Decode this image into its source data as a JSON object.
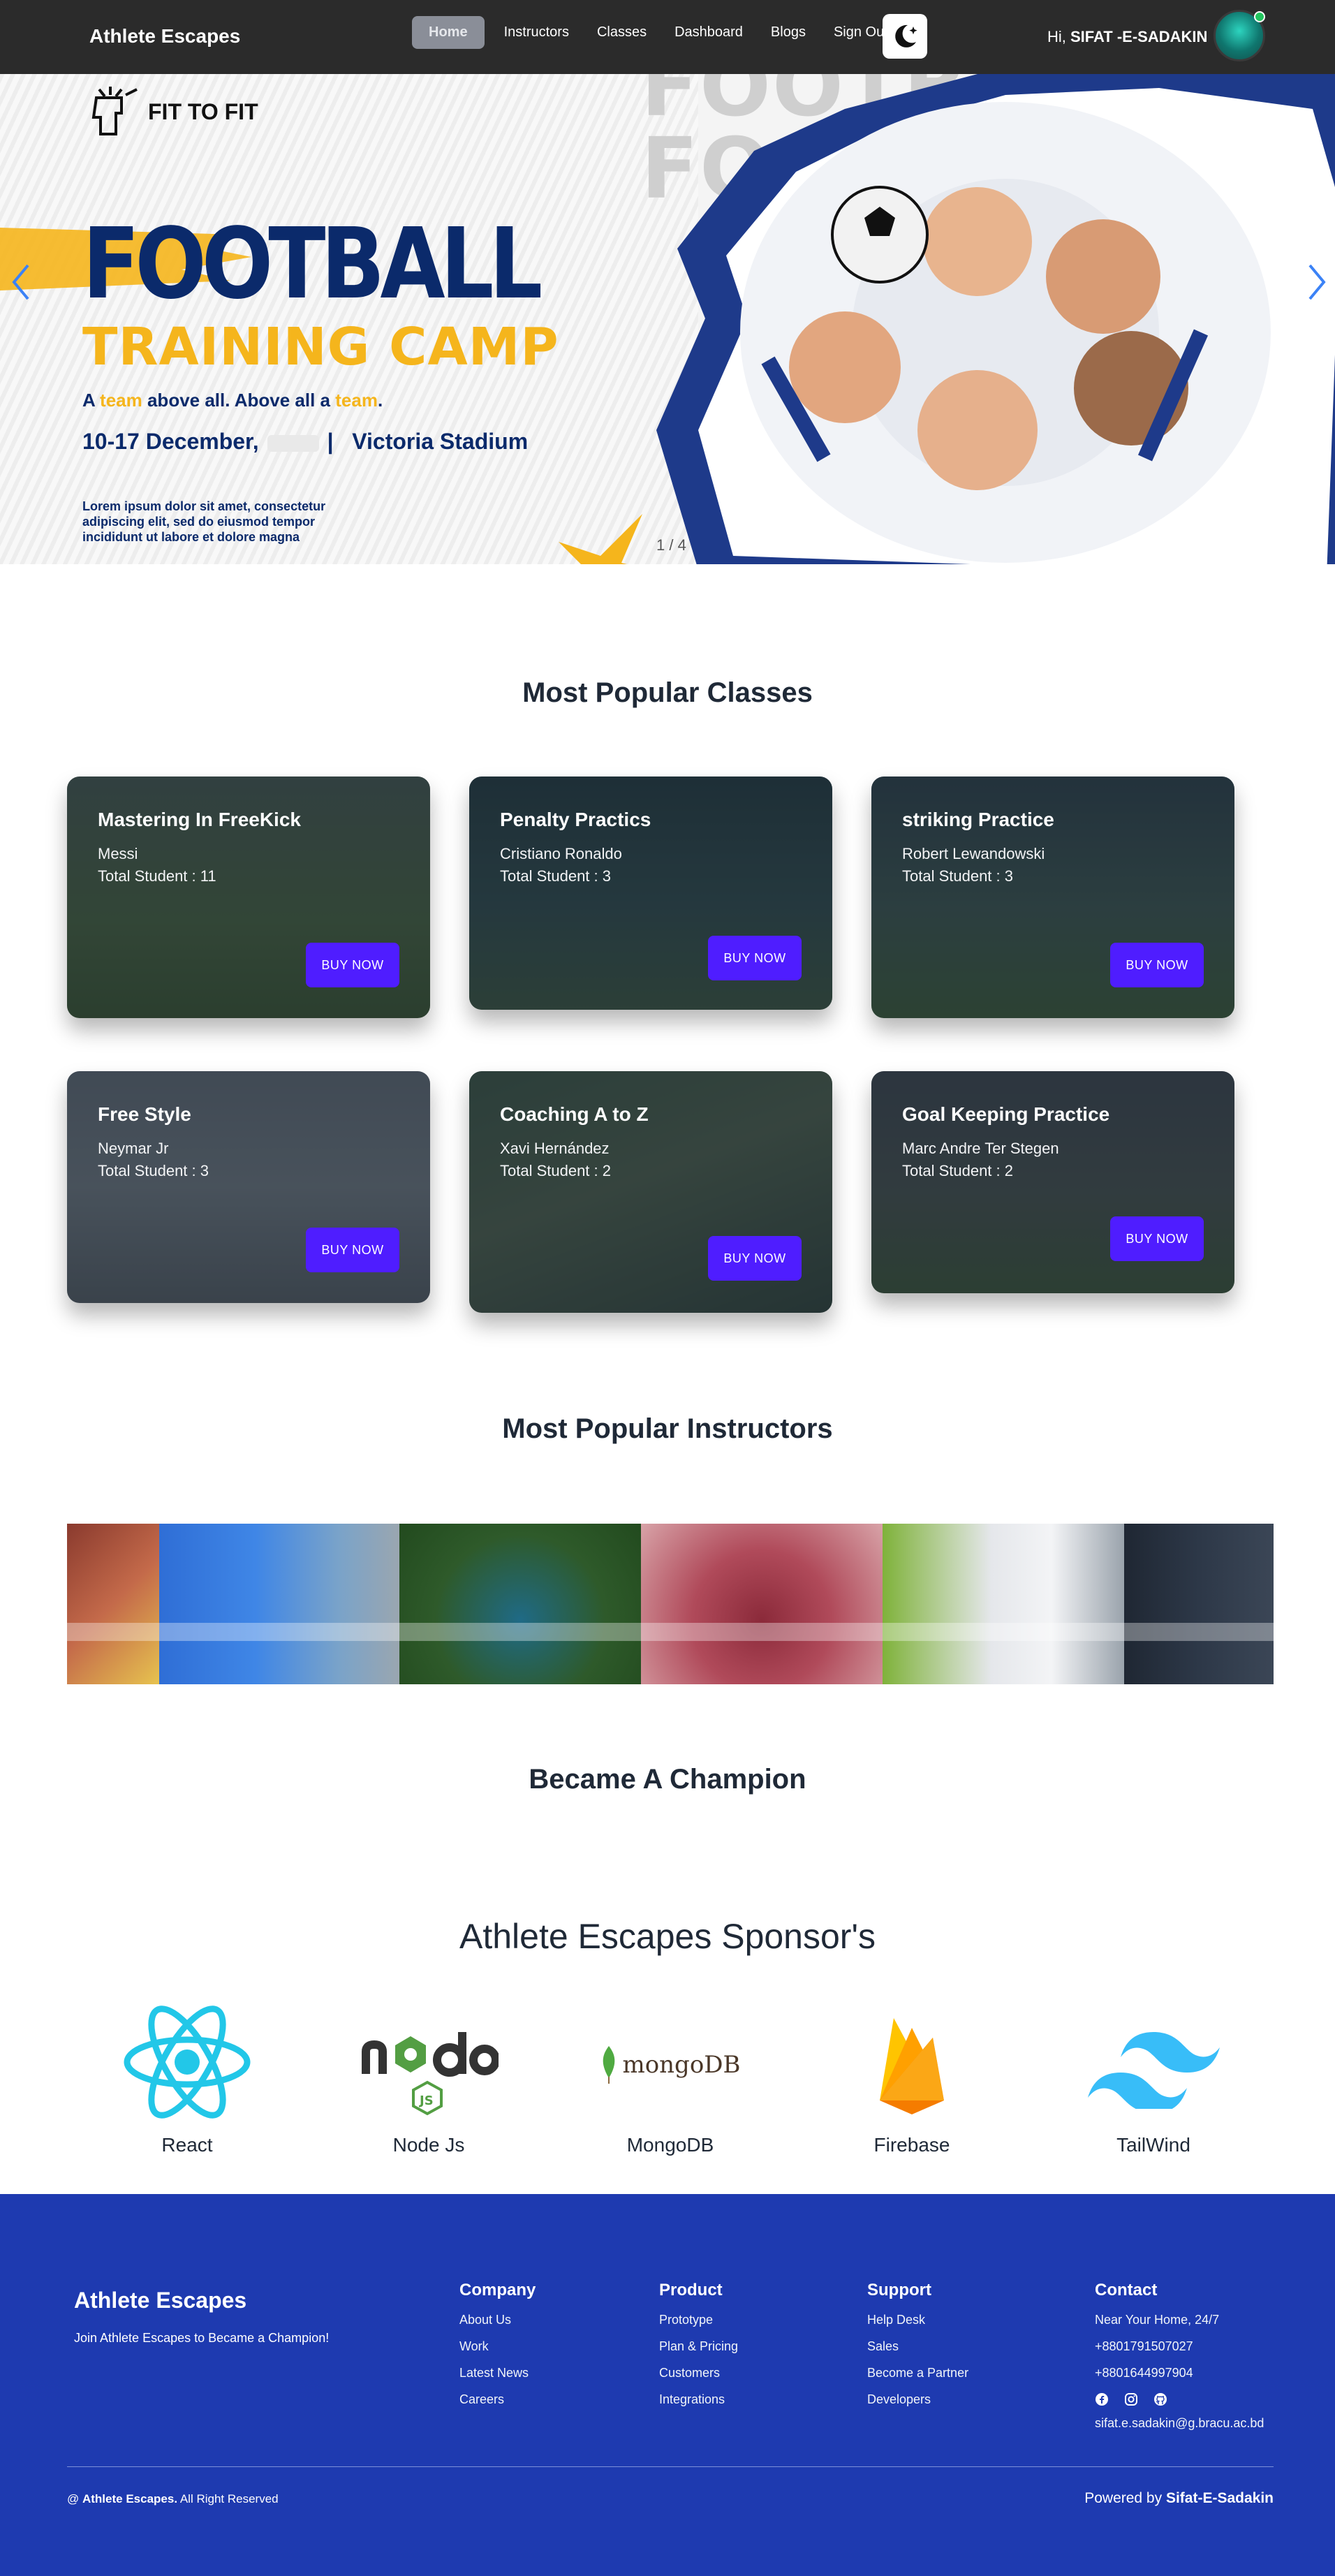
{
  "navbar": {
    "brand": "Athlete Escapes",
    "links": [
      "Home",
      "Instructors",
      "Classes",
      "Dashboard",
      "Blogs",
      "Sign Out"
    ],
    "active_link": "Home",
    "greeting_prefix": "Hi, ",
    "user_name": "SIFAT -E-SADAKIN",
    "theme_icon": "moon-icon"
  },
  "hero": {
    "logo_text": "FIT TO FIT",
    "ghost_text": "FOOTBALL",
    "title": "FOOTBALL",
    "subtitle": "TRAINING CAMP",
    "tagline_parts": [
      "A ",
      "team",
      " above all. Above all a ",
      "team",
      "."
    ],
    "date": "10-17 December,",
    "separator": "|",
    "venue": "Victoria Stadium",
    "lorem": "Lorem ipsum dolor sit amet, consectetur adipiscing elit, sed do eiusmod tempor incididunt ut labore et dolore magna",
    "counter": "1 / 4"
  },
  "classes_section": {
    "title": "Most Popular Classes",
    "buy_label": "BUY NOW",
    "student_prefix": "Total Student : ",
    "cards": [
      {
        "title": "Mastering In FreeKick",
        "instructor": "Messi",
        "students": "11",
        "bg": "#3f5a3a"
      },
      {
        "title": "Penalty Practics",
        "instructor": "Cristiano Ronaldo",
        "students": "3",
        "bg": "#2c4a4a"
      },
      {
        "title": "striking Practice",
        "instructor": "Robert Lewandowski",
        "students": "3",
        "bg": "#3c4e48"
      },
      {
        "title": "Free Style",
        "instructor": "Neymar Jr",
        "students": "3",
        "bg": "#5b6470"
      },
      {
        "title": "Coaching A to Z",
        "instructor": "Xavi Hernández",
        "students": "2",
        "bg": "#3b4d42"
      },
      {
        "title": "Goal Keeping Practice",
        "instructor": "Marc Andre Ter Stegen",
        "students": "2",
        "bg": "#404a48"
      }
    ]
  },
  "instructors_section": {
    "title": "Most Popular Instructors"
  },
  "champion_section": {
    "title": "Became A Champion"
  },
  "sponsors_section": {
    "title": "Athlete Escapes Sponsor's",
    "sponsors": [
      {
        "name": "React",
        "icon": "react-icon"
      },
      {
        "name": "Node Js",
        "icon": "nodejs-icon"
      },
      {
        "name": "MongoDB",
        "icon": "mongodb-icon"
      },
      {
        "name": "Firebase",
        "icon": "firebase-icon"
      },
      {
        "name": "TailWind",
        "icon": "tailwind-icon"
      }
    ],
    "mongodb_wordmark": "mongoDB"
  },
  "footer": {
    "brand": "Athlete Escapes",
    "tagline": "Join Athlete Escapes to Became a Champion!",
    "company": {
      "heading": "Company",
      "items": [
        "About Us",
        "Work",
        "Latest News",
        "Careers"
      ]
    },
    "product": {
      "heading": "Product",
      "items": [
        "Prototype",
        "Plan & Pricing",
        "Customers",
        "Integrations"
      ]
    },
    "support": {
      "heading": "Support",
      "items": [
        "Help Desk",
        "Sales",
        "Become a Partner",
        "Developers"
      ]
    },
    "contact": {
      "heading": "Contact",
      "items": [
        "Near Your Home, 24/7",
        "+8801791507027",
        "+8801644997904"
      ],
      "email": "sifat.e.sadakin@g.bracu.ac.bd"
    },
    "copyright_prefix": "@ ",
    "copyright_brand": "Athlete Escapes.",
    "copyright_suffix": " All Right Reserved",
    "powered_prefix": "Powered by ",
    "powered_name": "Sifat-E-Sadakin"
  },
  "colors": {
    "navbar": "#2b2b2b",
    "accent_button": "#4f1dff",
    "footer": "#1e3ab0",
    "hero_navy": "#0b2a6b",
    "hero_yellow": "#f5b51c"
  }
}
